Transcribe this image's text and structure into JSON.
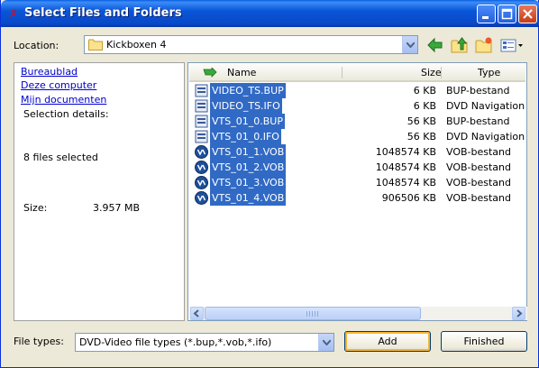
{
  "window": {
    "title": "Select Files and Folders"
  },
  "location": {
    "label": "Location:",
    "value": "Kickboxen 4"
  },
  "left_pane": {
    "links": [
      "Bureaublad",
      "Deze computer",
      "Mijn documenten"
    ],
    "selection_details_label": "Selection details:",
    "files_selected": "8 files selected",
    "size_label": "Size:",
    "size_value": "3.957 MB"
  },
  "columns": {
    "name": "Name",
    "size": "Size",
    "type": "Type"
  },
  "files": [
    {
      "name": "VIDEO_TS.BUP",
      "size": "6 KB",
      "type": "BUP-bestand",
      "icon": "ifo-file-icon"
    },
    {
      "name": "VIDEO_TS.IFO",
      "size": "6 KB",
      "type": "DVD Navigation Fi",
      "icon": "ifo-file-icon"
    },
    {
      "name": "VTS_01_0.BUP",
      "size": "56 KB",
      "type": "BUP-bestand",
      "icon": "ifo-file-icon"
    },
    {
      "name": "VTS_01_0.IFO",
      "size": "56 KB",
      "type": "DVD Navigation Fi",
      "icon": "ifo-file-icon"
    },
    {
      "name": "VTS_01_1.VOB",
      "size": "1048574 KB",
      "type": "VOB-bestand",
      "icon": "vob-file-icon"
    },
    {
      "name": "VTS_01_2.VOB",
      "size": "1048574 KB",
      "type": "VOB-bestand",
      "icon": "vob-file-icon"
    },
    {
      "name": "VTS_01_3.VOB",
      "size": "1048574 KB",
      "type": "VOB-bestand",
      "icon": "vob-file-icon"
    },
    {
      "name": "VTS_01_4.VOB",
      "size": "906506 KB",
      "type": "VOB-bestand",
      "icon": "vob-file-icon"
    }
  ],
  "file_types": {
    "label": "File types:",
    "value": "DVD-Video file types (*.bup,*.vob,*.ifo)"
  },
  "buttons": {
    "add": "Add",
    "finished": "Finished"
  },
  "colors": {
    "selection": "#316ac5",
    "titlebar": "#0a56d8",
    "link": "#0000cc"
  }
}
